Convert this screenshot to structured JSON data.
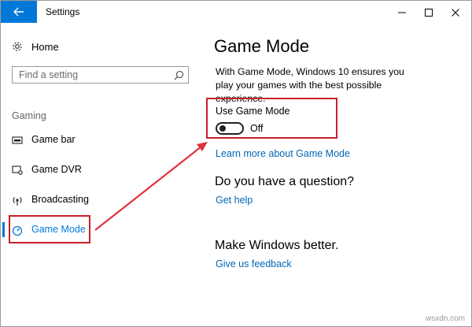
{
  "window": {
    "title": "Settings",
    "back_icon": "back-arrow-icon",
    "controls": [
      "minimize-icon",
      "maximize-icon",
      "close-icon"
    ],
    "accent_color": "#0078d7"
  },
  "sidebar": {
    "home": {
      "label": "Home",
      "icon": "gear-icon"
    },
    "search": {
      "placeholder": "Find a setting",
      "icon": "search-icon"
    },
    "section_label": "Gaming",
    "items": [
      {
        "label": "Game bar",
        "icon": "game-bar-icon",
        "active": false
      },
      {
        "label": "Game DVR",
        "icon": "game-dvr-icon",
        "active": false
      },
      {
        "label": "Broadcasting",
        "icon": "broadcasting-icon",
        "active": false
      },
      {
        "label": "Game Mode",
        "icon": "game-mode-icon",
        "active": true
      }
    ]
  },
  "main": {
    "title": "Game Mode",
    "description": "With Game Mode, Windows 10 ensures you play your games with the best possible experience.",
    "setting": {
      "label": "Use Game Mode",
      "toggle_on": false,
      "state_text": "Off"
    },
    "learn_more_link": "Learn more about Game Mode",
    "question_heading": "Do you have a question?",
    "help_link": "Get help",
    "feedback_heading": "Make Windows better.",
    "feedback_link": "Give us feedback"
  },
  "annotations": {
    "highlight_color": "#c8202a"
  },
  "watermark": "wsxdn.com"
}
